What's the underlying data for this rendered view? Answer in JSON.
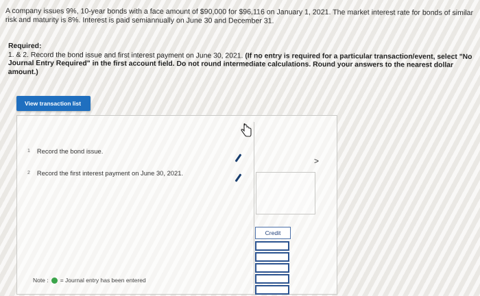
{
  "problem": {
    "text": "A company issues 9%, 10-year bonds with a face amount of $90,000 for $96,116 on January 1, 2021. The market interest rate for bonds of similar risk and maturity is 8%. Interest is paid semiannually on June 30 and December 31."
  },
  "required": {
    "title": "Required:",
    "line1_plain": "1. & 2. Record the bond issue and first interest payment on June 30, 2021.",
    "line1_bold": "(If no entry is required for a particular transaction/event, select \"No Journal Entry Required\" in the first account field. Do not round intermediate calculations. Round your answers to the nearest dollar amount.)"
  },
  "buttons": {
    "view_transaction_list": "View transaction list"
  },
  "transactions": [
    {
      "num": "1",
      "label": "Record the bond issue."
    },
    {
      "num": "2",
      "label": "Record the first interest payment on June 30, 2021."
    }
  ],
  "journal": {
    "credit_header": "Credit",
    "next_arrow": ">"
  },
  "note": {
    "prefix": "Note :",
    "text": "= Journal entry has been entered"
  },
  "colors": {
    "button_blue": "#1f6fbf",
    "entered_green": "#3aa44a",
    "pencil_navy": "#163c6e"
  }
}
